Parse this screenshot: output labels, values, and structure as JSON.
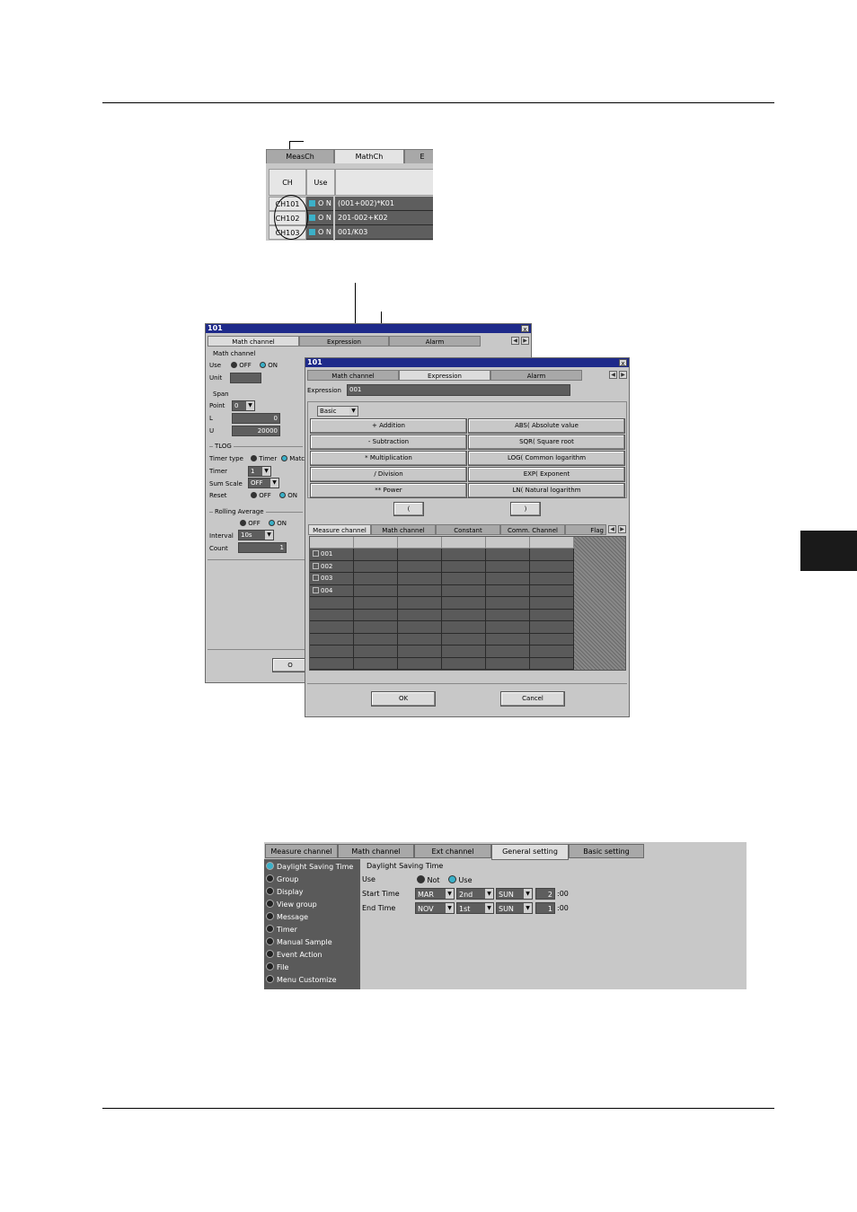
{
  "figure1": {
    "tabs": [
      "MeasCh",
      "MathCh",
      "E"
    ],
    "headers": {
      "ch": "CH",
      "use": "Use"
    },
    "rows": [
      {
        "ch": "CH101",
        "use": "O N",
        "expr": "(001+002)*K01"
      },
      {
        "ch": "CH102",
        "use": "O N",
        "expr": "201-002+K02"
      },
      {
        "ch": "CH103",
        "use": "O N",
        "expr": "001/K03"
      }
    ]
  },
  "dialog_back": {
    "title": "101",
    "close": "x",
    "tabs": [
      "Math channel",
      "Expression",
      "Alarm"
    ],
    "group_math": "Math channel",
    "use_label": "Use",
    "off_label": "OFF",
    "on_label": "ON",
    "unit_label": "Unit",
    "span_label": "Span",
    "point_label": "Point",
    "point_value": "0",
    "l_label": "L",
    "l_value": "0",
    "u_label": "U",
    "u_value": "20000",
    "tlog_label": "TLOG",
    "timer_type_label": "Timer type",
    "timer_opt": "Timer",
    "match_opt": "Matc",
    "timer_label": "Timer",
    "timer_value": "1",
    "sum_scale_label": "Sum Scale",
    "sum_scale_value": "OFF",
    "reset_label": "Reset",
    "rolling_label": "Rolling Average",
    "interval_label": "Interval",
    "interval_value": "10s",
    "count_label": "Count",
    "count_value": "1",
    "ok_partial": "O"
  },
  "dialog_front": {
    "title": "101",
    "close": "x",
    "tabs": [
      "Math channel",
      "Expression",
      "Alarm"
    ],
    "expression_label": "Expression",
    "expression_value": "001",
    "mode_value": "Basic",
    "operators_left": [
      "+ Addition",
      "- Subtraction",
      "* Multiplication",
      "/ Division",
      "** Power"
    ],
    "operators_right": [
      "ABS( Absolute value",
      "SQR( Square root",
      "LOG( Common logarithm",
      "EXP( Exponent",
      "LN( Natural logarithm"
    ],
    "paren_open": "(",
    "paren_close": ")",
    "sub_tabs": [
      "Measure channel",
      "Math channel",
      "Constant",
      "Comm. Channel",
      "Flag"
    ],
    "channels": [
      "001",
      "002",
      "003",
      "004"
    ],
    "ok": "OK",
    "cancel": "Cancel"
  },
  "figure3": {
    "tabs": [
      "Measure channel",
      "Math channel",
      "Ext channel",
      "General setting",
      "Basic setting"
    ],
    "sidebar": [
      "Daylight Saving Time",
      "Group",
      "Display",
      "View group",
      "Message",
      "Timer",
      "Manual Sample",
      "Event Action",
      "File",
      "Menu Customize"
    ],
    "heading": "Daylight Saving Time",
    "use_label": "Use",
    "not_label": "Not",
    "use_opt": "Use",
    "start_label": "Start Time",
    "end_label": "End Time",
    "start": {
      "month": "MAR",
      "week": "2nd",
      "day": "SUN",
      "hour": "2",
      "min": ":00"
    },
    "end": {
      "month": "NOV",
      "week": "1st",
      "day": "SUN",
      "hour": "1",
      "min": ":00"
    }
  }
}
